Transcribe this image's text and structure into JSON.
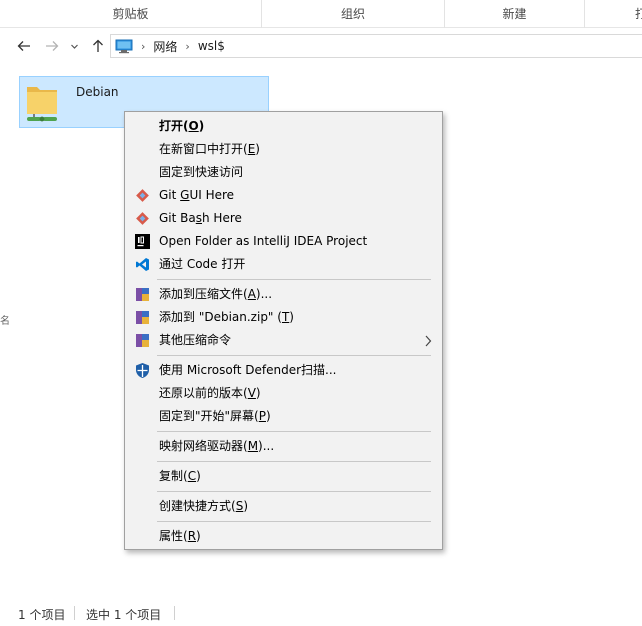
{
  "ribbon": {
    "groups": [
      "剪贴板",
      "组织",
      "新建",
      "打"
    ]
  },
  "nav": {
    "path": [
      "网络",
      "wsl$"
    ]
  },
  "items": [
    {
      "name": "Debian"
    }
  ],
  "side_marker": "名",
  "status": {
    "count": "1 个项目",
    "selected": "选中 1 个项目"
  },
  "context_menu": {
    "open": {
      "label": "打开(",
      "key": "O",
      "end": ")"
    },
    "open_new_window": {
      "label": "在新窗口中打开(",
      "key": "E",
      "end": ")"
    },
    "pin_quick_access": {
      "label": "固定到快速访问"
    },
    "git_gui": {
      "label": "Git ",
      "key": "G",
      "end": "UI Here"
    },
    "git_bash": {
      "label": "Git Ba",
      "key": "s",
      "end": "h Here"
    },
    "intellij": {
      "label": "Open Folder as IntelliJ IDEA Project"
    },
    "vscode": {
      "label": "通过 Code 打开"
    },
    "add_archive": {
      "label": "添加到压缩文件(",
      "key": "A",
      "end": ")..."
    },
    "add_zip": {
      "label": "添加到 \"Debian.zip\" (",
      "key": "T",
      "end": ")"
    },
    "other_compress": {
      "label": "其他压缩命令"
    },
    "defender": {
      "label": "使用 Microsoft Defender扫描..."
    },
    "restore": {
      "label": "还原以前的版本(",
      "key": "V",
      "end": ")"
    },
    "pin_start": {
      "label": "固定到\"开始\"屏幕(",
      "key": "P",
      "end": ")"
    },
    "map_drive": {
      "label": "映射网络驱动器(",
      "key": "M",
      "end": ")..."
    },
    "copy": {
      "label": "复制(",
      "key": "C",
      "end": ")"
    },
    "shortcut": {
      "label": "创建快捷方式(",
      "key": "S",
      "end": ")"
    },
    "properties": {
      "label": "属性(",
      "key": "R",
      "end": ")"
    }
  },
  "colors": {
    "selection_bg": "#cce8ff",
    "selection_border": "#99d1ff",
    "menu_bg": "#f2f2f2",
    "vscode_blue": "#0078d4"
  }
}
